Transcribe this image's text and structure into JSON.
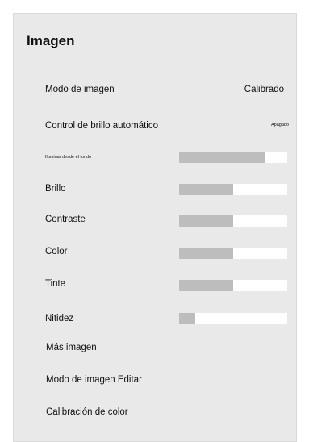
{
  "panel": {
    "title": "Imagen",
    "picture_mode": {
      "label": "Modo de imagen",
      "value": "Calibrado"
    },
    "auto_brightness": {
      "label": "Control de brillo automático",
      "value": "Apagado"
    },
    "sliders": [
      {
        "label": "Iluminar desde el fondo",
        "level": 0.8
      },
      {
        "label": "Brillo",
        "level": 0.5
      },
      {
        "label": "Contraste",
        "level": 0.5
      },
      {
        "label": "Color",
        "level": 0.5
      },
      {
        "label": "Tinte",
        "level": 0.5
      },
      {
        "label": "Nitidez",
        "level": 0.15
      }
    ],
    "more_picture": {
      "label": "Más imagen"
    },
    "edit_picture_mode": {
      "label": "Modo de imagen Editar"
    },
    "color_calibration": {
      "label": "Calibración de color"
    }
  }
}
